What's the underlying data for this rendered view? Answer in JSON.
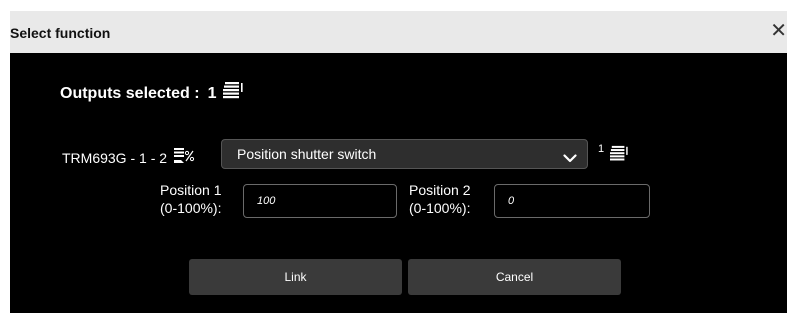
{
  "dialog": {
    "title": "Select function",
    "close_glyph": "✕"
  },
  "outputs": {
    "label": "Outputs selected :",
    "count": "1",
    "icon": "shutter-stack-icon"
  },
  "device": {
    "name": "TRM693G - 1 - 2",
    "icon": "shutter-percent-icon"
  },
  "function_select": {
    "value": "Position shutter switch",
    "icon": "chevron-down-icon",
    "after_count": "1",
    "after_icon": "shutter-stack-icon"
  },
  "position1": {
    "label_line1": "Position 1",
    "label_line2": "(0-100%):",
    "value": "100"
  },
  "position2": {
    "label_line1": "Position 2",
    "label_line2": "(0-100%):",
    "value": "0"
  },
  "buttons": {
    "link": "Link",
    "cancel": "Cancel"
  },
  "colors": {
    "titlebar": "#e9e9e9",
    "content_bg": "#000000",
    "button_bg": "#3a3a3a",
    "select_bg": "#2e2e2e"
  }
}
